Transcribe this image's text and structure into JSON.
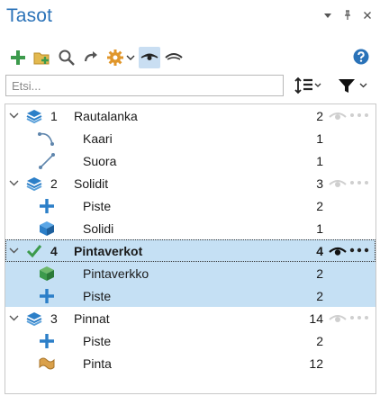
{
  "panel": {
    "title": "Tasot",
    "colors": {
      "title": "#2a72b8",
      "selection": "#c5e0f4",
      "accent": "#2a72b8"
    }
  },
  "window_controls": [
    "dropdown-icon",
    "pin-icon",
    "close-icon"
  ],
  "toolbar": {
    "buttons": [
      "add-layer-icon",
      "add-folder-icon",
      "search-icon",
      "undo-icon",
      "settings-icon",
      "visible-eye-icon",
      "hidden-eye-icon"
    ],
    "active": "visible-eye-icon",
    "help_icon": "help-icon"
  },
  "search": {
    "placeholder": "Etsi..."
  },
  "tree": {
    "groups": [
      {
        "index": "1",
        "name": "Rautalanka",
        "count": "2",
        "expanded": true,
        "children": [
          {
            "name": "Kaari",
            "count": "1",
            "icon": "arc-icon"
          },
          {
            "name": "Suora",
            "count": "1",
            "icon": "line-icon"
          }
        ]
      },
      {
        "index": "2",
        "name": "Solidit",
        "count": "3",
        "expanded": true,
        "children": [
          {
            "name": "Piste",
            "count": "2",
            "icon": "point-icon"
          },
          {
            "name": "Solidi",
            "count": "1",
            "icon": "solid-icon"
          }
        ]
      },
      {
        "index": "4",
        "name": "Pintaverkot",
        "count": "4",
        "expanded": true,
        "active": true,
        "children": [
          {
            "name": "Pintaverkko",
            "count": "2",
            "icon": "mesh-icon"
          },
          {
            "name": "Piste",
            "count": "2",
            "icon": "point-icon"
          }
        ]
      },
      {
        "index": "3",
        "name": "Pinnat",
        "count": "14",
        "expanded": true,
        "children": [
          {
            "name": "Piste",
            "count": "2",
            "icon": "point-icon"
          },
          {
            "name": "Pinta",
            "count": "12",
            "icon": "surface-icon"
          }
        ]
      }
    ]
  }
}
